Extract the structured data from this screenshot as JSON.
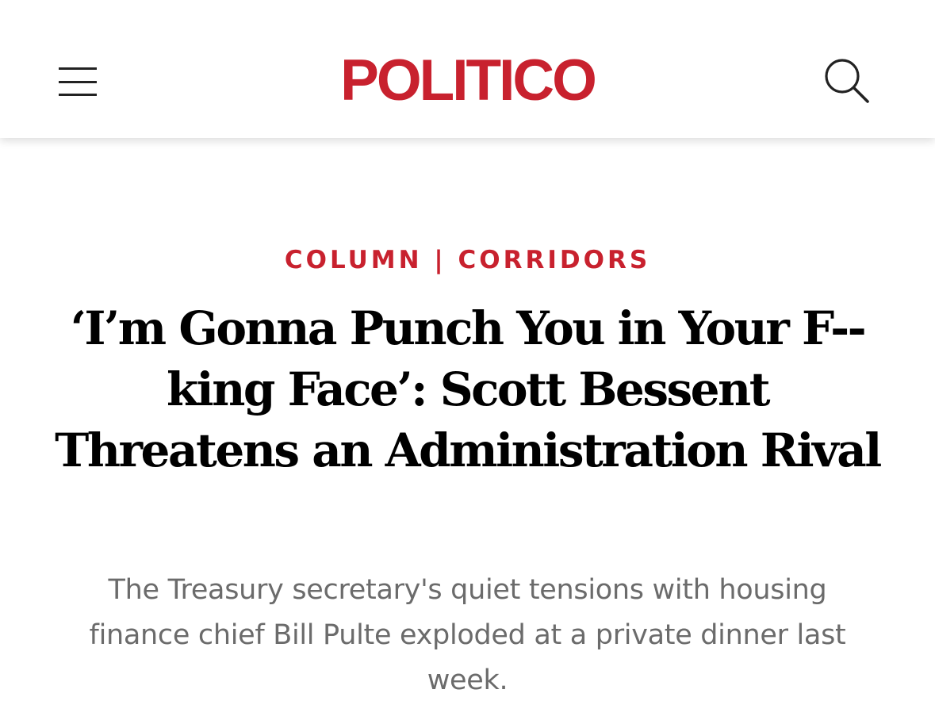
{
  "header": {
    "logo": "POLITICO",
    "menu_icon": "hamburger-menu-icon",
    "search_icon": "search-icon",
    "brand_color": "#c8212e"
  },
  "article": {
    "kicker_section": "COLUMN",
    "kicker_separator": "|",
    "kicker_series": "CORRIDORS",
    "headline": "‘I’m Gonna Punch You in Your F--king Face’: Scott Bessent Threatens an Administration Rival",
    "dek": "The Treasury secretary's quiet tensions with housing finance chief Bill Pulte exploded at a private dinner last week."
  }
}
